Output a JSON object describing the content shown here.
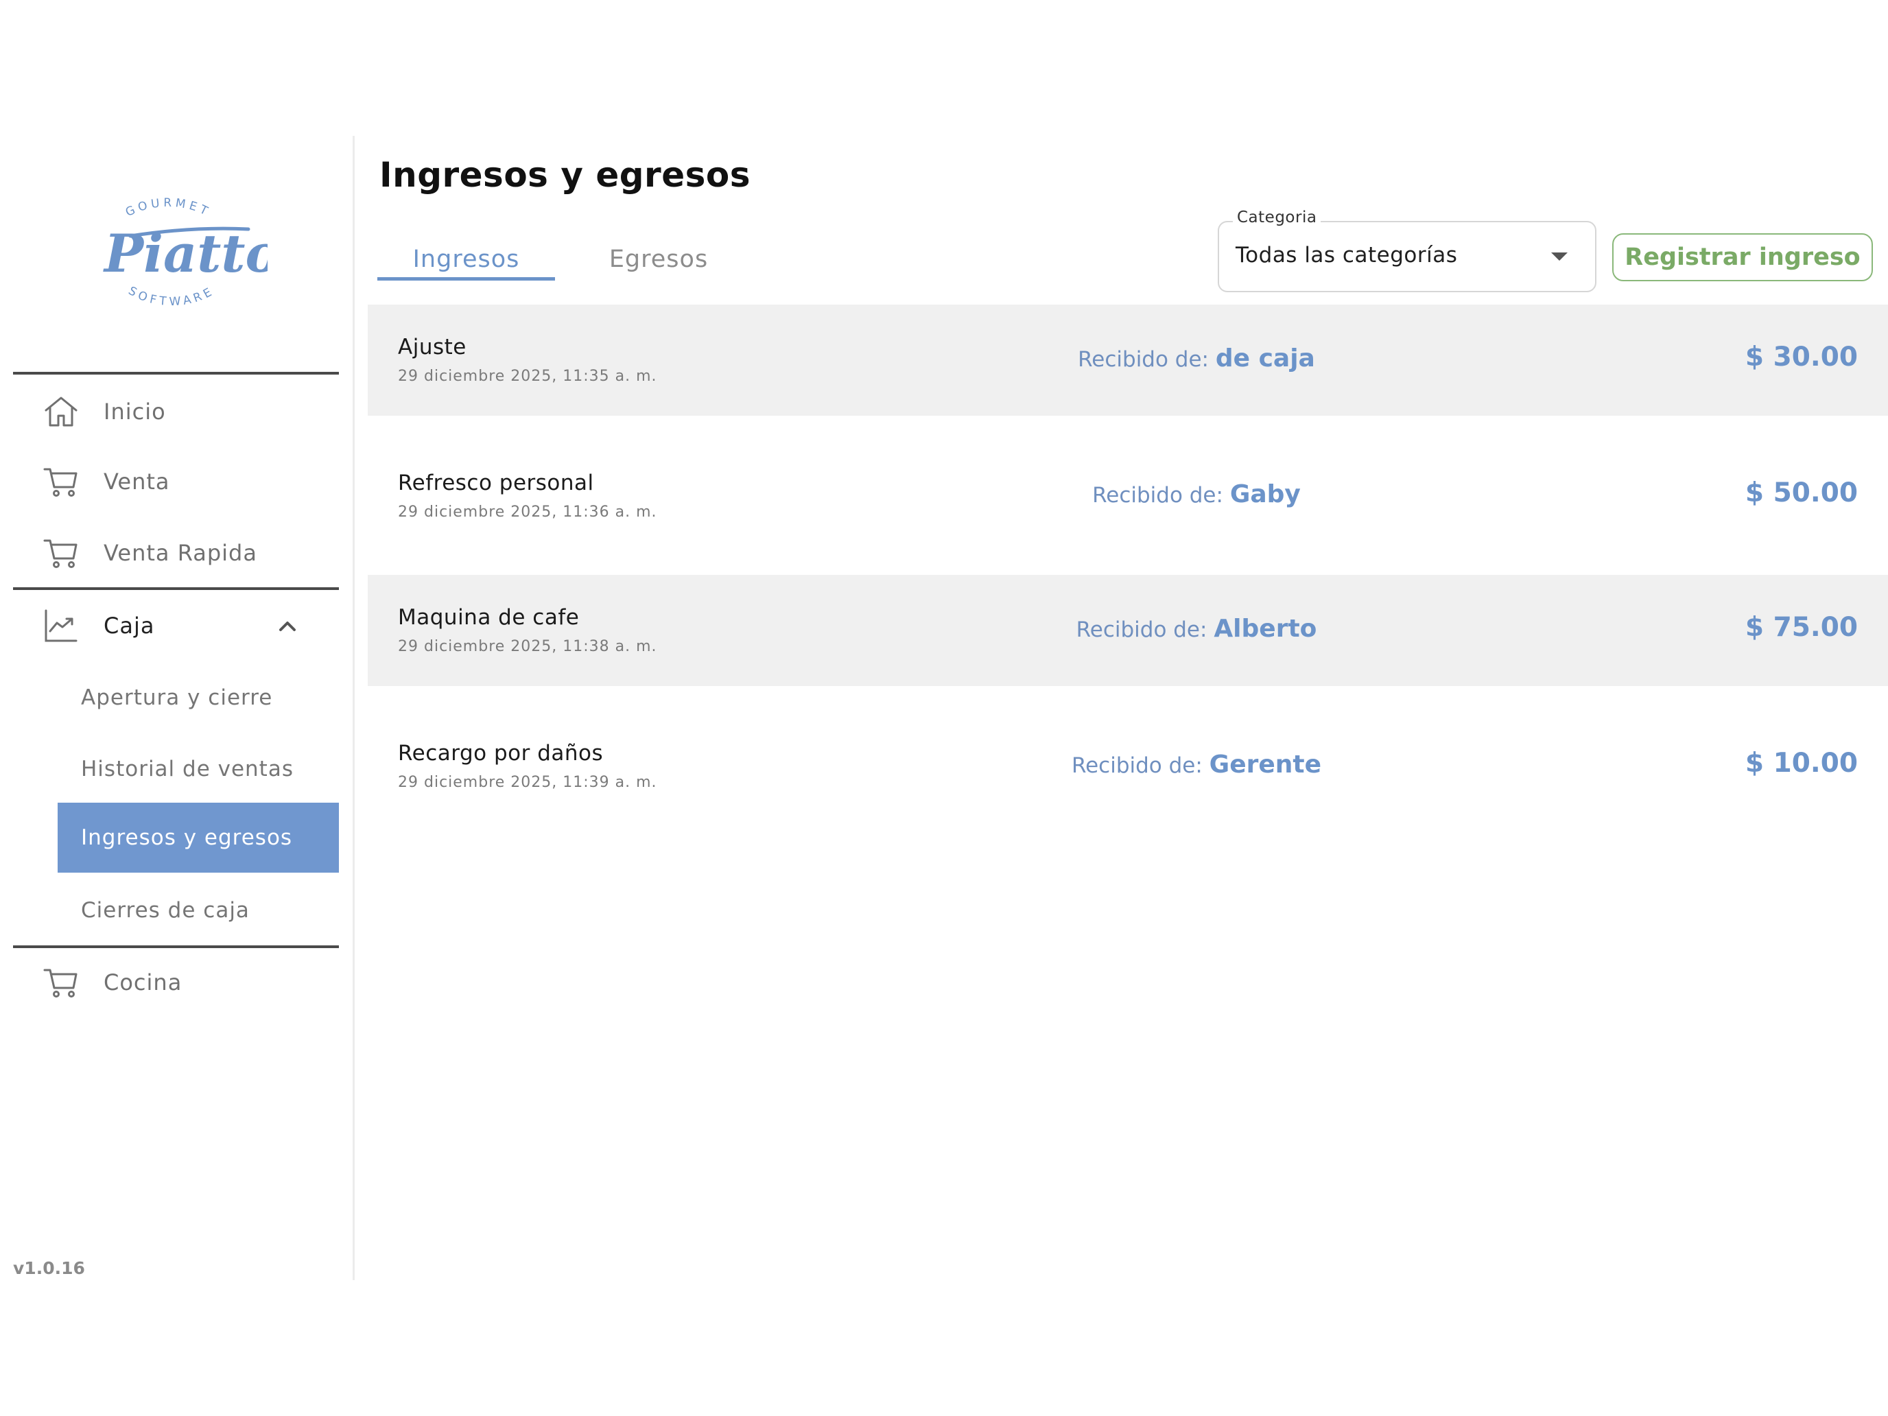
{
  "brand": {
    "name": "Piatto",
    "top_text": "GOURMET",
    "bottom_text": "SOFTWARE",
    "color": "#6b93c9"
  },
  "sidebar": {
    "items": [
      {
        "label": "Inicio",
        "icon": "home-icon"
      },
      {
        "label": "Venta",
        "icon": "cart-icon"
      },
      {
        "label": "Venta Rapida",
        "icon": "cart-icon"
      },
      {
        "label": "Caja",
        "icon": "chart-line-icon",
        "expanded": true
      },
      {
        "label": "Cocina",
        "icon": "cart-icon"
      }
    ],
    "caja_subitems": [
      {
        "label": "Apertura y cierre"
      },
      {
        "label": "Historial de ventas"
      },
      {
        "label": "Ingresos y egresos",
        "active": true
      },
      {
        "label": "Cierres de caja"
      }
    ],
    "version": "v1.0.16"
  },
  "main": {
    "title": "Ingresos y egresos",
    "tabs": [
      {
        "label": "Ingresos",
        "active": true
      },
      {
        "label": "Egresos",
        "active": false
      }
    ],
    "category_filter": {
      "label": "Categoria",
      "value": "Todas las categorías"
    },
    "register_button": "Registrar ingreso",
    "received_prefix": "Recibido de: ",
    "entries": [
      {
        "title": "Ajuste",
        "date": "29 diciembre 2025, 11:35 a. m.",
        "received_from": "de caja",
        "amount": "$ 30.00"
      },
      {
        "title": "Refresco personal",
        "date": "29 diciembre 2025, 11:36 a. m.",
        "received_from": "Gaby",
        "amount": "$ 50.00"
      },
      {
        "title": "Maquina de cafe",
        "date": "29 diciembre 2025, 11:38 a. m.",
        "received_from": "Alberto",
        "amount": "$ 75.00"
      },
      {
        "title": "Recargo por daños",
        "date": "29 diciembre 2025, 11:39 a. m.",
        "received_from": "Gerente",
        "amount": "$ 10.00"
      }
    ]
  },
  "colors": {
    "accent": "#6b93c9",
    "active_nav_bg": "#7097cf",
    "register_green": "#7aaa66",
    "row_shade": "#f0f0f0"
  }
}
